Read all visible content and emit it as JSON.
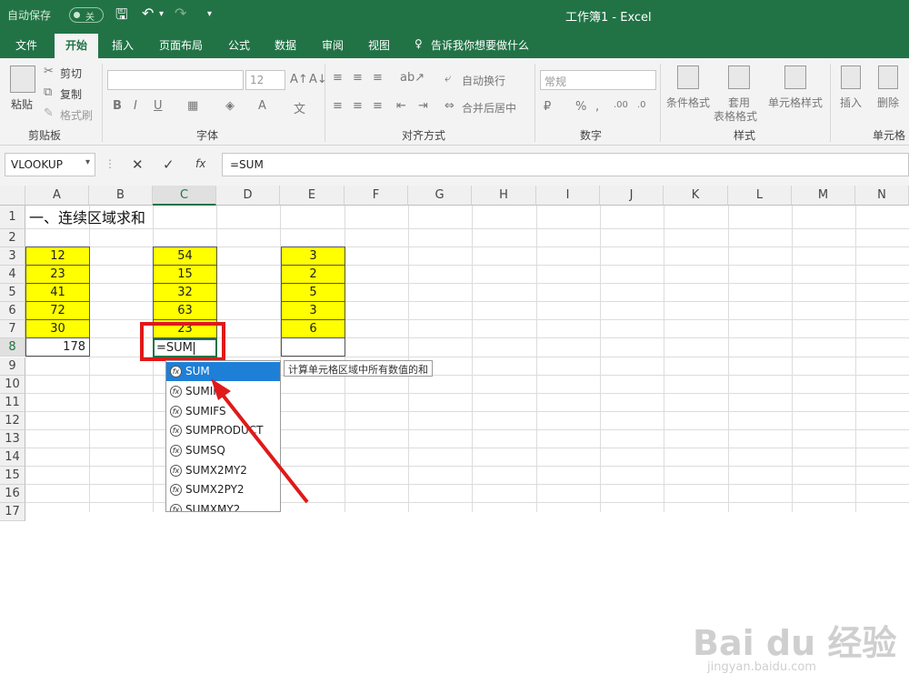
{
  "titlebar": {
    "autosave": "自动保存",
    "toggle": "关",
    "window_title": "工作簿1  -  Excel"
  },
  "tabs": [
    "文件",
    "开始",
    "插入",
    "页面布局",
    "公式",
    "数据",
    "审阅",
    "视图"
  ],
  "tell_me": "告诉我你想要做什么",
  "ribbon": {
    "paste": "粘贴",
    "cut": "剪切",
    "copy": "复制",
    "format_painter": "格式刷",
    "clipboard": "剪贴板",
    "font_size": "12",
    "font": "字体",
    "wrap_text": "自动换行",
    "merge_center": "合并后居中",
    "alignment": "对齐方式",
    "number_format": "常规",
    "number": "数字",
    "conditional": "条件格式",
    "table_format_1": "套用",
    "table_format_2": "表格格式",
    "cell_style": "单元格样式",
    "styles": "样式",
    "insert": "插入",
    "delete": "删除",
    "cells": "单元格"
  },
  "formula_bar": {
    "namebox": "VLOOKUP",
    "formula": "=SUM"
  },
  "columns": [
    "A",
    "B",
    "C",
    "D",
    "E",
    "F",
    "G",
    "H",
    "I",
    "J",
    "K",
    "L",
    "M",
    "N"
  ],
  "rows": [
    "1",
    "2",
    "3",
    "4",
    "5",
    "6",
    "7",
    "8",
    "9",
    "10",
    "11",
    "12",
    "13",
    "14",
    "15",
    "16",
    "17"
  ],
  "sheet": {
    "heading": "一、连续区域求和",
    "colA": [
      "12",
      "23",
      "41",
      "72",
      "30"
    ],
    "colC": [
      "54",
      "15",
      "32",
      "63",
      "23"
    ],
    "colE": [
      "3",
      "2",
      "5",
      "3",
      "6"
    ],
    "a8": "178",
    "c8": "=SUM"
  },
  "autocomplete": [
    "SUM",
    "SUMIF",
    "SUMIFS",
    "SUMPRODUCT",
    "SUMSQ",
    "SUMX2MY2",
    "SUMX2PY2",
    "SUMXMY2"
  ],
  "tooltip": "计算单元格区域中所有数值的和",
  "watermark": {
    "main": "Bai du 经验",
    "sub": "jingyan.baidu.com"
  },
  "colors": {
    "excel_green": "#217346",
    "highlight": "#ffff00",
    "annotation": "#e01919",
    "selection": "#1e7fd7"
  }
}
